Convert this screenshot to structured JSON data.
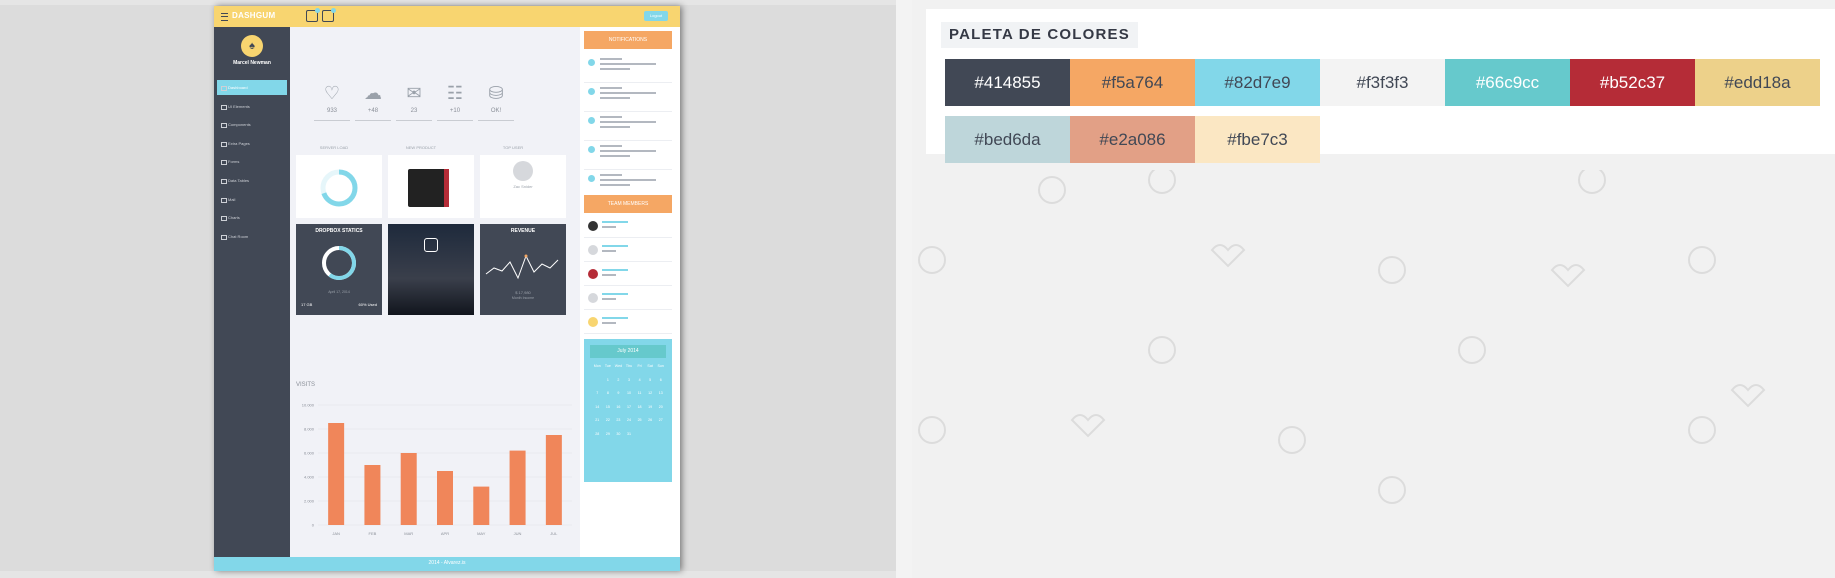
{
  "dashboard": {
    "logo": "DASHGUM",
    "logout": "Logout",
    "user_name": "Marcel Newman",
    "sidebar": [
      {
        "label": "Dashboard",
        "active": true
      },
      {
        "label": "UI Elements"
      },
      {
        "label": "Components"
      },
      {
        "label": "Extra Pages"
      },
      {
        "label": "Forms"
      },
      {
        "label": "Data Tables"
      },
      {
        "label": "Mail"
      },
      {
        "label": "Charts"
      },
      {
        "label": "Chat Room"
      }
    ],
    "stats": [
      {
        "icon": "heart-icon",
        "value": "933"
      },
      {
        "icon": "cloud-icon",
        "value": "+48"
      },
      {
        "icon": "inbox-icon",
        "value": "23"
      },
      {
        "icon": "newspaper-icon",
        "value": "+10"
      },
      {
        "icon": "database-icon",
        "value": "OK!"
      }
    ],
    "card_labels": [
      "SERVER LOAD",
      "NEW PRODUCT",
      "TOP USER"
    ],
    "top_user": "Zac Snider",
    "dropbox_title": "DROPBOX STATICS",
    "dropbox_date": "April 17, 2014",
    "dropbox_size": "17 GB",
    "dropbox_used": "60% Used",
    "revenue_title": "REVENUE",
    "revenue_value": "$ 17,980",
    "revenue_sub": "Month Income",
    "visits_title": "VISITS",
    "visits": {
      "type": "bar",
      "categories": [
        "JAN",
        "FEB",
        "MAR",
        "APR",
        "MAY",
        "JUN",
        "JUL"
      ],
      "values": [
        8500,
        5000,
        6000,
        4500,
        3200,
        6200,
        7500
      ],
      "ylim": [
        0,
        10000
      ],
      "yticks": [
        "0",
        "2.000",
        "4.000",
        "6.000",
        "8.000",
        "10.000"
      ],
      "color": "#f0865a"
    },
    "notifications_title": "NOTIFICATIONS",
    "team_title": "TEAM MEMBERS",
    "calendar": {
      "month": "July 2014",
      "weekdays": [
        "Mon",
        "Tue",
        "Wed",
        "Thu",
        "Fri",
        "Sat",
        "Sun"
      ],
      "days": [
        "",
        "1",
        "2",
        "3",
        "4",
        "5",
        "6",
        "7",
        "8",
        "9",
        "10",
        "11",
        "12",
        "13",
        "14",
        "15",
        "16",
        "17",
        "18",
        "19",
        "20",
        "21",
        "22",
        "23",
        "24",
        "25",
        "26",
        "27",
        "28",
        "29",
        "30",
        "31",
        "",
        "",
        ""
      ]
    },
    "footer": "2014 - Alvarez.is"
  },
  "palette": {
    "title": "PALETA DE COLORES",
    "swatches": [
      {
        "hex": "#414855",
        "text_color": "#ffffff"
      },
      {
        "hex": "#f5a764",
        "text_color": "#414855"
      },
      {
        "hex": "#82d7e9",
        "text_color": "#414855"
      },
      {
        "hex": "#f3f3f3",
        "text_color": "#414855"
      },
      {
        "hex": "#66c9cc",
        "text_color": "#ffffff"
      },
      {
        "hex": "#b52c37",
        "text_color": "#ffffff"
      },
      {
        "hex": "#edd18a",
        "text_color": "#414855"
      },
      {
        "hex": "#bed6da",
        "text_color": "#414855"
      },
      {
        "hex": "#e2a086",
        "text_color": "#414855"
      },
      {
        "hex": "#fbe7c3",
        "text_color": "#414855"
      }
    ]
  }
}
